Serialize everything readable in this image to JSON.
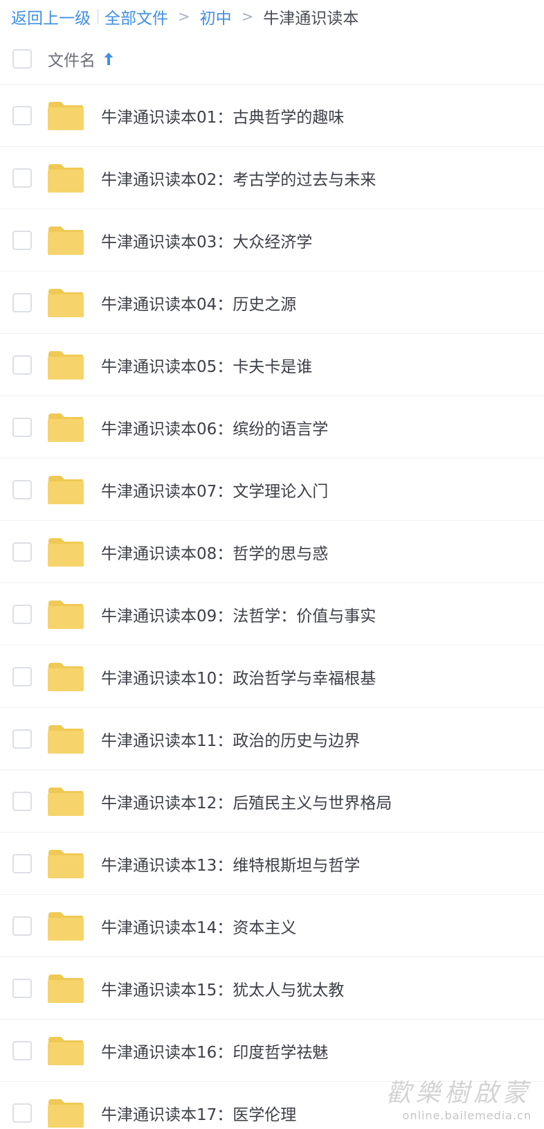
{
  "breadcrumb": {
    "back": "返回上一级",
    "all_files": "全部文件",
    "separator": ">",
    "level1": "初中",
    "current": "牛津通识读本"
  },
  "header": {
    "column_name": "文件名"
  },
  "colors": {
    "link": "#3f8fe4",
    "folder": "#f6d46b",
    "folder_tab": "#f0c955"
  },
  "files": [
    {
      "name": "牛津通识读本01：古典哲学的趣味",
      "icon": "folder-icon"
    },
    {
      "name": "牛津通识读本02：考古学的过去与未来",
      "icon": "folder-icon"
    },
    {
      "name": "牛津通识读本03：大众经济学",
      "icon": "folder-icon"
    },
    {
      "name": "牛津通识读本04：历史之源",
      "icon": "folder-icon"
    },
    {
      "name": "牛津通识读本05：卡夫卡是谁",
      "icon": "folder-icon"
    },
    {
      "name": "牛津通识读本06：缤纷的语言学",
      "icon": "folder-icon"
    },
    {
      "name": "牛津通识读本07：文学理论入门",
      "icon": "folder-icon"
    },
    {
      "name": "牛津通识读本08：哲学的思与惑",
      "icon": "folder-icon"
    },
    {
      "name": "牛津通识读本09：法哲学：价值与事实",
      "icon": "folder-icon"
    },
    {
      "name": "牛津通识读本10：政治哲学与幸福根基",
      "icon": "folder-icon"
    },
    {
      "name": "牛津通识读本11：政治的历史与边界",
      "icon": "folder-icon"
    },
    {
      "name": "牛津通识读本12：后殖民主义与世界格局",
      "icon": "folder-icon"
    },
    {
      "name": "牛津通识读本13：维特根斯坦与哲学",
      "icon": "folder-icon"
    },
    {
      "name": "牛津通识读本14：资本主义",
      "icon": "folder-icon"
    },
    {
      "name": "牛津通识读本15：犹太人与犹太教",
      "icon": "folder-icon"
    },
    {
      "name": "牛津通识读本16：印度哲学祛魅",
      "icon": "folder-icon"
    },
    {
      "name": "牛津通识读本17：医学伦理",
      "icon": "folder-icon"
    }
  ],
  "watermark": {
    "title": "歡樂樹啟蒙",
    "url": "online.bailemedia.cn"
  }
}
